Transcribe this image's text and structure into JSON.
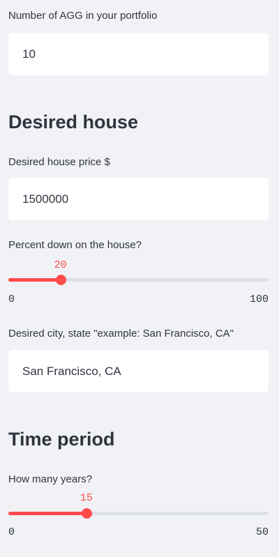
{
  "fields": {
    "agg": {
      "label": "Number of AGG in your portfolio",
      "value": "10"
    },
    "price": {
      "label": "Desired house price $",
      "value": "1500000"
    },
    "city": {
      "label": "Desired city, state \"example: San Francisco, CA\"",
      "value": "San Francisco, CA"
    }
  },
  "headings": {
    "house": "Desired house",
    "time": "Time period"
  },
  "sliders": {
    "percent_down": {
      "label": "Percent down on the house?",
      "value": 20,
      "min": 0,
      "max": 100,
      "value_text": "20",
      "min_text": "0",
      "max_text": "100"
    },
    "years": {
      "label": "How many years?",
      "value": 15,
      "min": 0,
      "max": 50,
      "value_text": "15",
      "min_text": "0",
      "max_text": "50"
    }
  },
  "colors": {
    "accent": "#ff4b4b",
    "background": "#f0f2f6",
    "text": "#31333f"
  }
}
